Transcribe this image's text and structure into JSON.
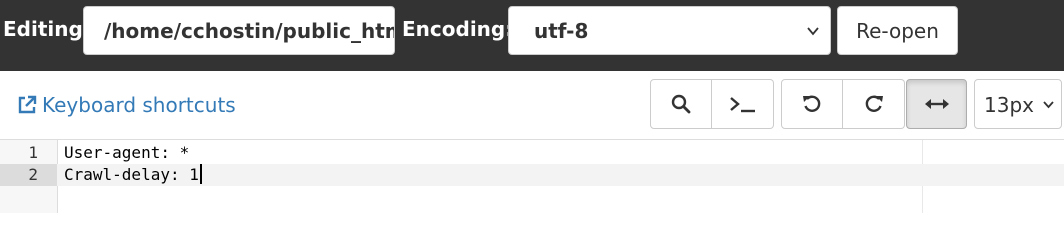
{
  "topbar": {
    "editing_label": "Editing:",
    "path_value": "/home/cchostin/public_html/robots.txt",
    "encoding_label": "Encoding:",
    "encoding_value": "utf-8",
    "reopen_label": "Re-open"
  },
  "toolbar": {
    "keyboard_shortcuts_label": "Keyboard shortcuts",
    "font_size_value": "13px",
    "buttons": [
      "search-icon",
      "terminal-icon",
      "undo-icon",
      "redo-icon",
      "wrap-icon"
    ]
  },
  "editor": {
    "lines": [
      {
        "number": "1",
        "text": "User-agent: *"
      },
      {
        "number": "2",
        "text": "Crawl-delay: 1"
      }
    ]
  },
  "colors": {
    "topbar_bg": "#333333",
    "link": "#337ab7"
  }
}
